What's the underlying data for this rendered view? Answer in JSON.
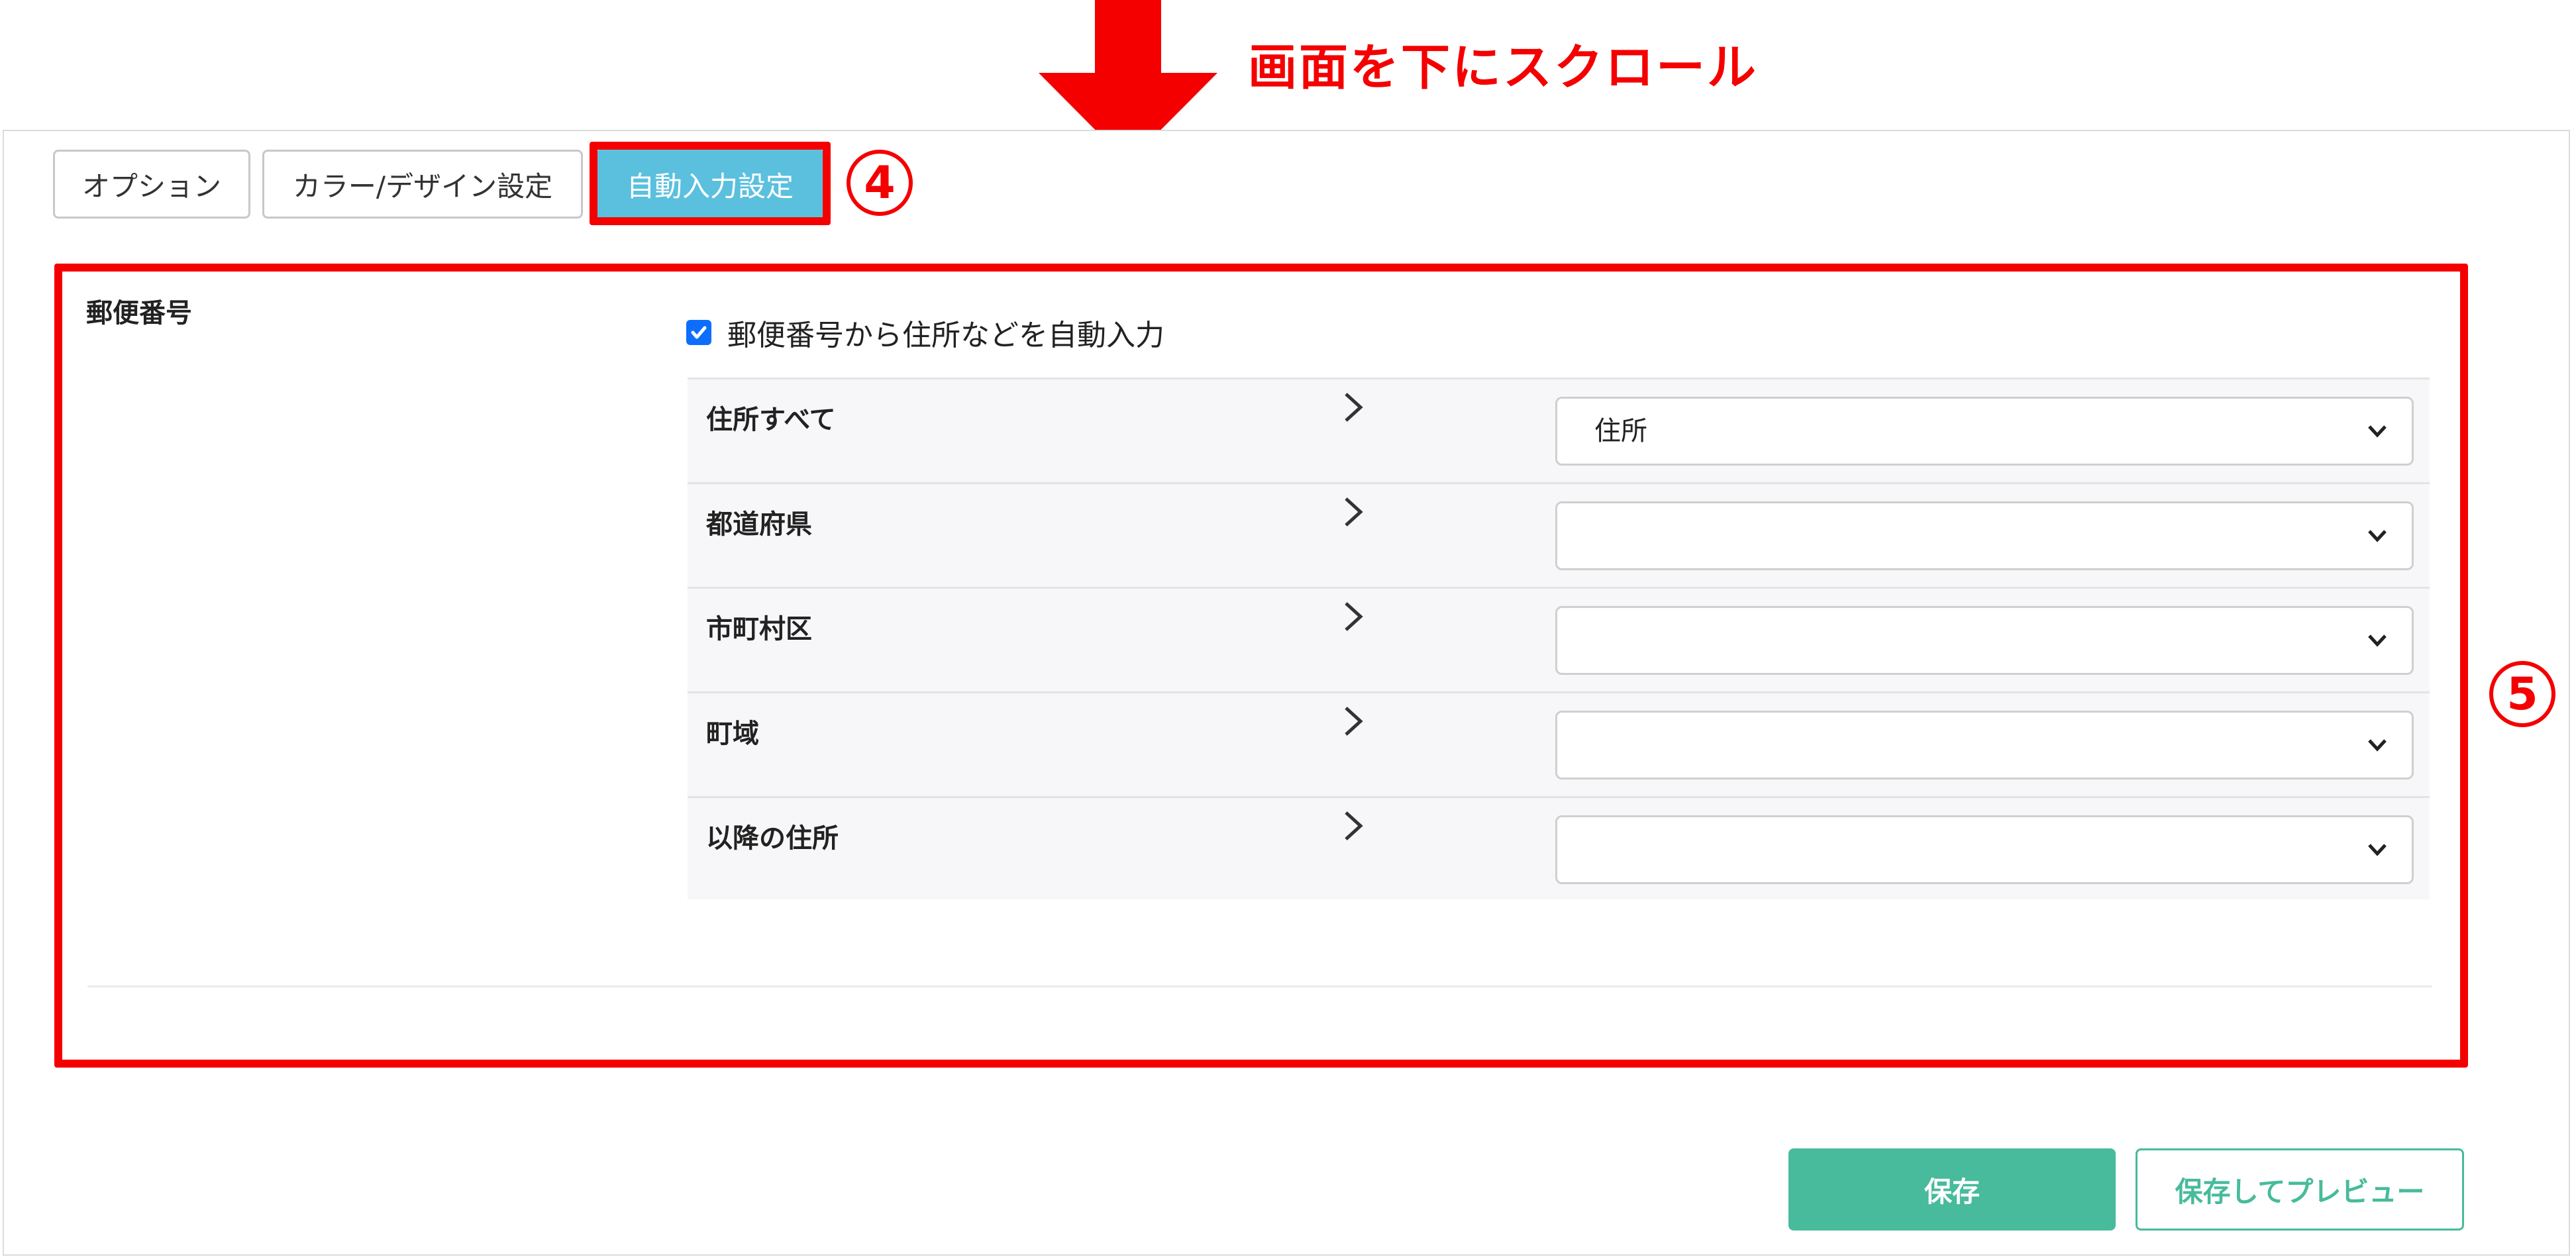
{
  "annotation": {
    "scroll_hint": "画面を下にスクロール",
    "step4": "4",
    "step5": "5",
    "color": "#f40000"
  },
  "tabs": [
    {
      "label": "オプション",
      "active": false
    },
    {
      "label": "カラー/デザイン設定",
      "active": false
    },
    {
      "label": "自動入力設定",
      "active": true
    }
  ],
  "section": {
    "title": "郵便番号",
    "auto_fill_checked": true,
    "auto_fill_label": "郵便番号から住所などを自動入力"
  },
  "mapping_rows": [
    {
      "label": "住所すべて",
      "selected": "住所"
    },
    {
      "label": "都道府県",
      "selected": ""
    },
    {
      "label": "市町村区",
      "selected": ""
    },
    {
      "label": "町域",
      "selected": ""
    },
    {
      "label": "以降の住所",
      "selected": ""
    }
  ],
  "buttons": {
    "save": "保存",
    "save_preview": "保存してプレビュー"
  },
  "colors": {
    "active_tab": "#5bc0de",
    "primary": "#47bb9b",
    "checkbox": "#0d6efd"
  }
}
